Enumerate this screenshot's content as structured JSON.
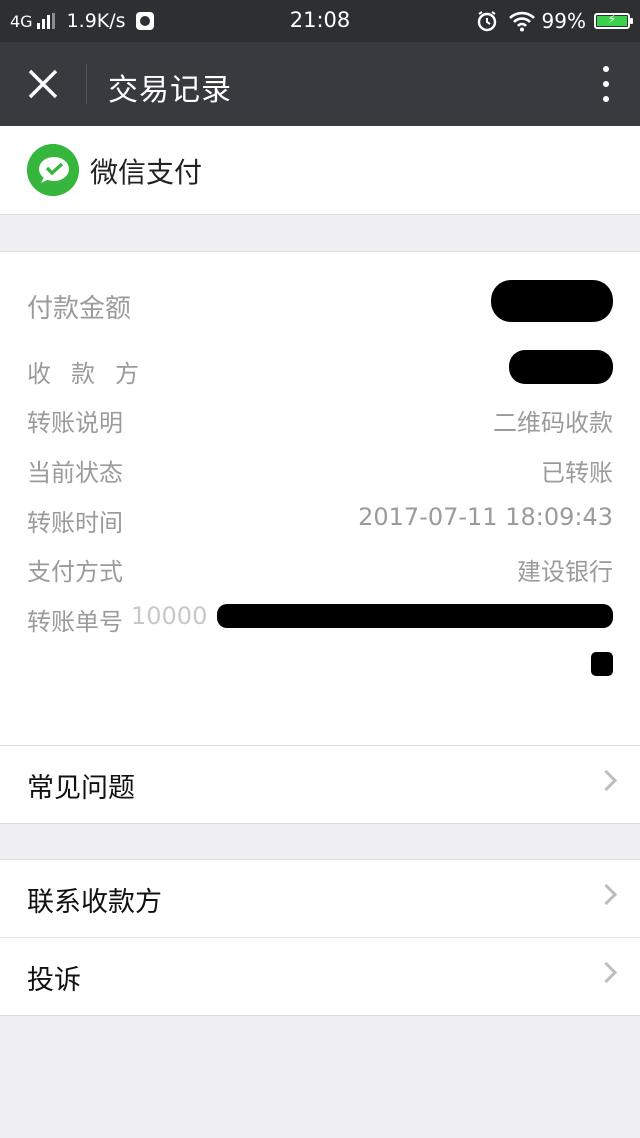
{
  "status_bar": {
    "network": "4G",
    "speed": "1.9K/s",
    "time": "21:08",
    "battery": "99%",
    "icons": [
      "signal-icon",
      "app-icon",
      "alarm-icon",
      "wifi-icon",
      "battery-icon"
    ]
  },
  "navbar": {
    "title": "交易记录",
    "close_icon": "close-icon",
    "more_icon": "more-vertical-icon"
  },
  "pay_header": {
    "name": "微信支付",
    "logo_icon": "wechat-pay-icon",
    "brand_color": "#36b63c"
  },
  "details": {
    "amount_label": "付款金额",
    "payee_label": "收款方",
    "note_label": "转账说明",
    "note_value": "二维码收款",
    "status_label": "当前状态",
    "status_value": "已转账",
    "time_label": "转账时间",
    "time_value": "2017-07-11 18:09:43",
    "method_label": "支付方式",
    "method_value": "建设银行",
    "order_label": "转账单号",
    "order_value_prefix": "10000"
  },
  "menu": {
    "faq": "常见问题",
    "contact_payee": "联系收款方",
    "complaint": "投诉"
  }
}
